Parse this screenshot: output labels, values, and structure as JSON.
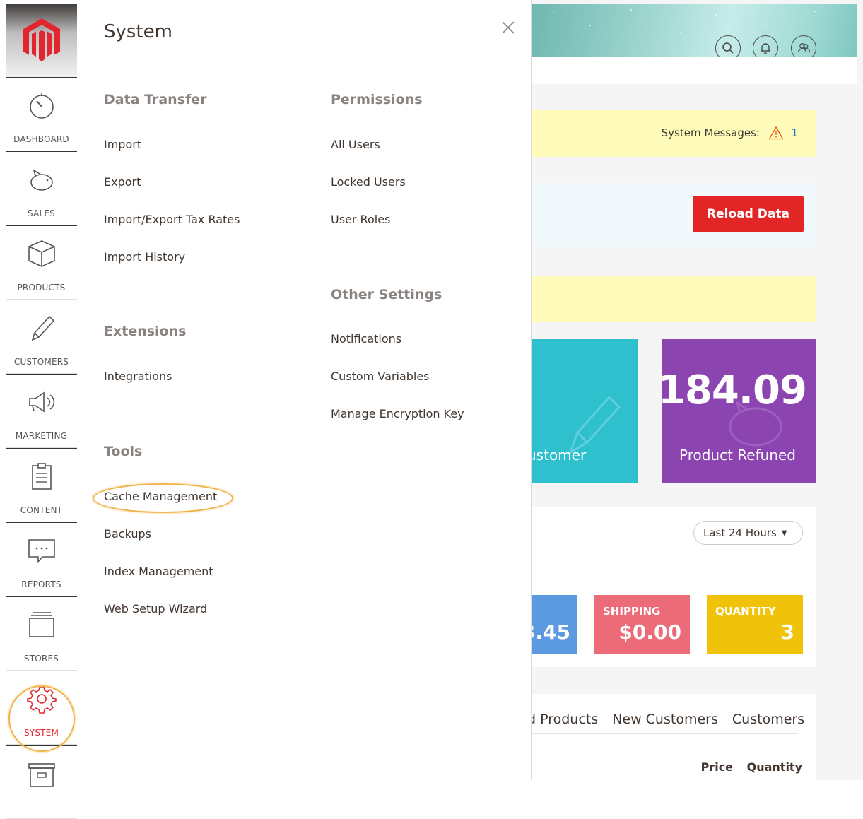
{
  "nav": {
    "items": [
      {
        "label": "DASHBOARD",
        "icon": "dashboard-icon"
      },
      {
        "label": "SALES",
        "icon": "piggy-bank-icon"
      },
      {
        "label": "PRODUCTS",
        "icon": "box-icon"
      },
      {
        "label": "CUSTOMERS",
        "icon": "pencil-icon"
      },
      {
        "label": "MARKETING",
        "icon": "megaphone-icon"
      },
      {
        "label": "CONTENT",
        "icon": "document-icon"
      },
      {
        "label": "REPORTS",
        "icon": "chat-bubble-icon"
      },
      {
        "label": "STORES",
        "icon": "store-icon"
      },
      {
        "label": "SYSTEM",
        "icon": "gear-icon"
      }
    ],
    "active_color": "#e3262d"
  },
  "flyout": {
    "title": "System",
    "sections": {
      "data_transfer": {
        "title": "Data Transfer",
        "links": [
          "Import",
          "Export",
          "Import/Export Tax Rates",
          "Import History"
        ]
      },
      "extensions": {
        "title": "Extensions",
        "links": [
          "Integrations"
        ]
      },
      "tools": {
        "title": "Tools",
        "links": [
          "Cache Management",
          "Backups",
          "Index Management",
          "Web Setup Wizard"
        ]
      },
      "permissions": {
        "title": "Permissions",
        "links": [
          "All Users",
          "Locked Users",
          "User Roles"
        ]
      },
      "other_settings": {
        "title": "Other Settings",
        "links": [
          "Notifications",
          "Custom Variables",
          "Manage Encryption Key"
        ]
      }
    }
  },
  "dashboard": {
    "system_messages_label": "System Messages:",
    "system_messages_count": "1",
    "reload_button": "Reload Data",
    "tile_customer_label": "ustomer",
    "tile_refunded_value": "184.09",
    "tile_refunded_label": "Product Refuned",
    "period_select": "Last 24 Hours",
    "stats": {
      "partial_value": "3.45",
      "shipping_label": "SHIPPING",
      "shipping_value": "$0.00",
      "quantity_label": "QUANTITY",
      "quantity_value": "3"
    },
    "tabs": [
      "d Products",
      "New Customers",
      "Customers"
    ],
    "columns": [
      "Price",
      "Quantity"
    ]
  },
  "colors": {
    "accent_red": "#e22626",
    "teal_tile": "#2fc0ce",
    "purple_tile": "#8c44b0",
    "message_yellow": "#fffbbb",
    "highlight_orange": "#f0b44c"
  }
}
